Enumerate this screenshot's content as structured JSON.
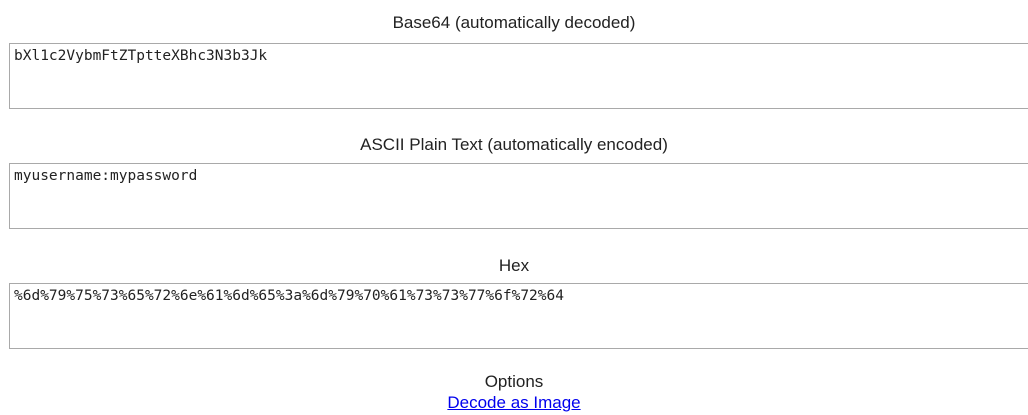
{
  "fields": {
    "base64": {
      "label": "Base64 (automatically decoded)",
      "value": "bXl1c2VybmFtZTptteXBhc3N3b3Jk"
    },
    "ascii": {
      "label": "ASCII Plain Text (automatically encoded)",
      "value": "myusername:mypassword"
    },
    "hex": {
      "label": "Hex",
      "value": "%6d%79%75%73%65%72%6e%61%6d%65%3a%6d%79%70%61%73%73%77%6f%72%64"
    }
  },
  "options": {
    "label": "Options",
    "decode_image_link": "Decode as Image"
  }
}
